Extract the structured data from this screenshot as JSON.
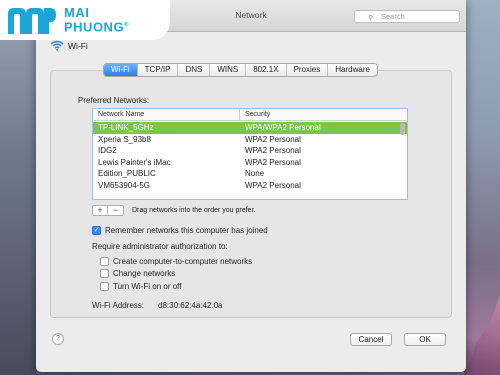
{
  "brand": {
    "line1": "MAI",
    "line2": "PHUONG",
    "trademark": "®",
    "color": "#1ba6d6"
  },
  "window": {
    "title": "Network"
  },
  "search": {
    "placeholder": "Search"
  },
  "header": {
    "label": "Wi-Fi"
  },
  "tabs": [
    {
      "label": "Wi-Fi",
      "active": true
    },
    {
      "label": "TCP/IP"
    },
    {
      "label": "DNS"
    },
    {
      "label": "WINS"
    },
    {
      "label": "802.1X"
    },
    {
      "label": "Proxies"
    },
    {
      "label": "Hardware"
    }
  ],
  "preferred": {
    "label": "Preferred Networks:",
    "columns": {
      "name": "Network Name",
      "security": "Security"
    },
    "rows": [
      {
        "name": "TP-LINK_5GHz",
        "security": "WPA/WPA2 Personal",
        "selected": true
      },
      {
        "name": "Xperia S_93b8",
        "security": "WPA2 Personal"
      },
      {
        "name": "IDG2",
        "security": "WPA2 Personal"
      },
      {
        "name": "Lewis Painter's iMac",
        "security": "WPA2 Personal"
      },
      {
        "name": "Edition_PUBLIC",
        "security": "None"
      },
      {
        "name": "VM653904-5G",
        "security": "WPA2 Personal"
      }
    ],
    "drag_hint": "Drag networks into the order you prefer.",
    "add_label": "+",
    "remove_label": "−"
  },
  "options": {
    "remember": {
      "label": "Remember networks this computer has joined",
      "checked": true
    },
    "require_label": "Require administrator authorization to:",
    "admin_items": [
      {
        "label": "Create computer-to-computer networks",
        "checked": false
      },
      {
        "label": "Change networks",
        "checked": false
      },
      {
        "label": "Turn Wi-Fi on or off",
        "checked": false
      }
    ],
    "address_label": "Wi-Fi Address:",
    "address_value": "d8:30:62:4a:42:0a"
  },
  "buttons": {
    "help": "?",
    "cancel": "Cancel",
    "ok": "OK"
  },
  "colors": {
    "selected_row": "#7cc44a",
    "active_tab": "#2a7ff0"
  }
}
